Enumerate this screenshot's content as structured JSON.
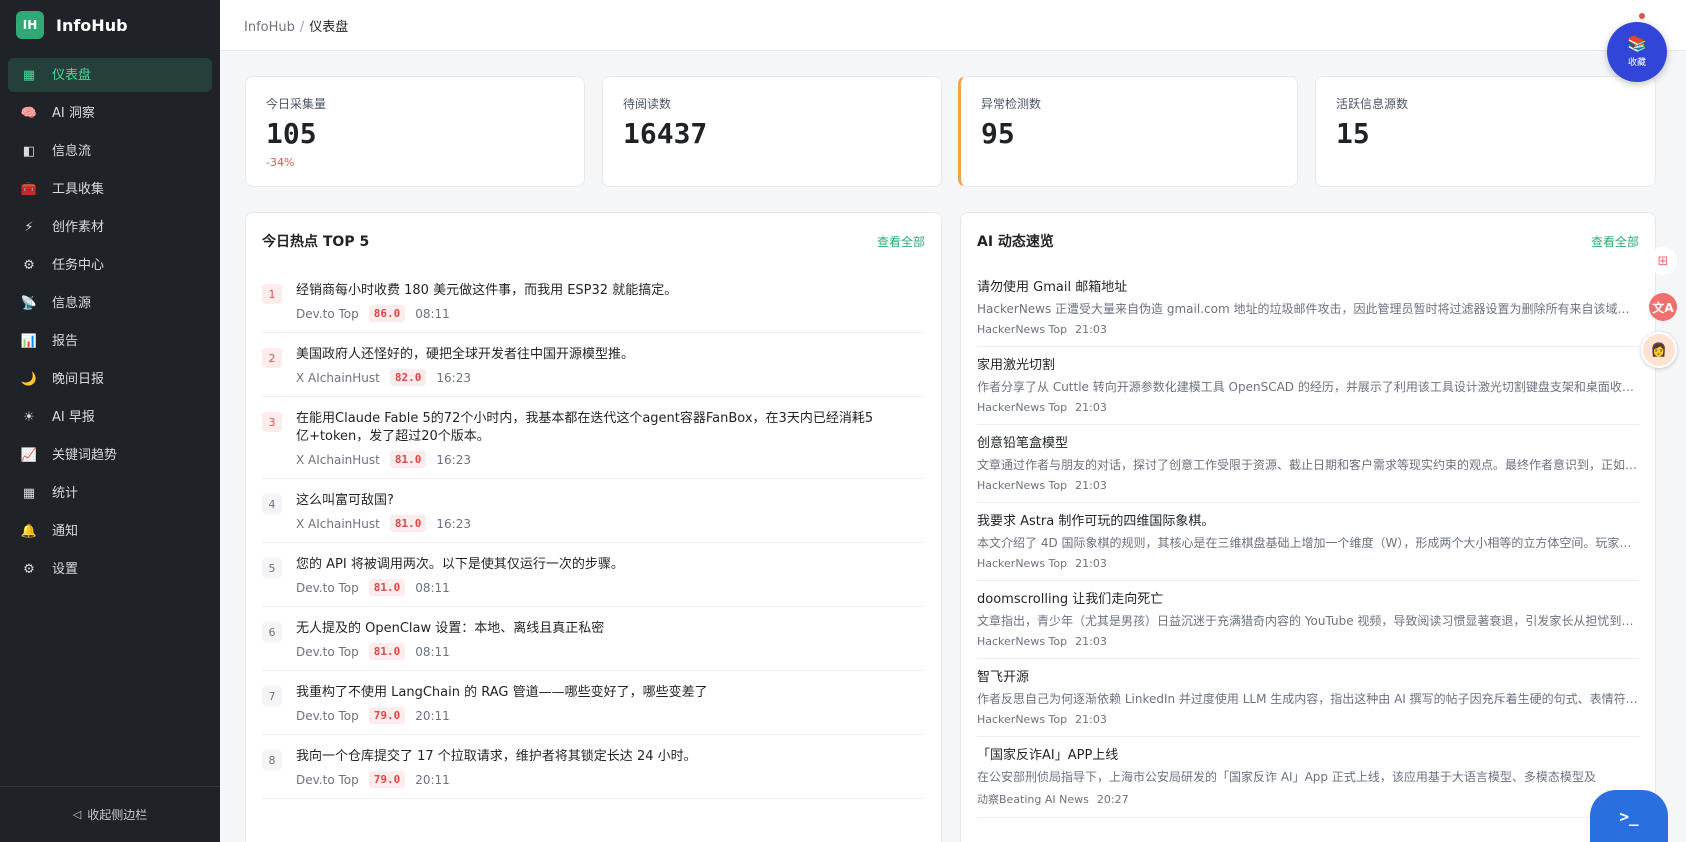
{
  "brand": {
    "logo": "IH",
    "name": "InfoHub"
  },
  "nav": [
    {
      "icon": "▦",
      "label": "仪表盘",
      "active": true
    },
    {
      "icon": "🧠",
      "label": "AI 洞察"
    },
    {
      "icon": "◧",
      "label": "信息流"
    },
    {
      "icon": "🧰",
      "label": "工具收集"
    },
    {
      "icon": "⚡",
      "label": "创作素材"
    },
    {
      "icon": "⚙",
      "label": "任务中心"
    },
    {
      "icon": "📡",
      "label": "信息源"
    },
    {
      "icon": "📊",
      "label": "报告"
    },
    {
      "icon": "🌙",
      "label": "晚间日报"
    },
    {
      "icon": "☀",
      "label": "AI 早报"
    },
    {
      "icon": "📈",
      "label": "关键词趋势"
    },
    {
      "icon": "▦",
      "label": "统计"
    },
    {
      "icon": "🔔",
      "label": "通知"
    },
    {
      "icon": "⚙",
      "label": "设置"
    }
  ],
  "collapse": {
    "icon": "◁",
    "label": "收起侧边栏"
  },
  "breadcrumb": {
    "root": "InfoHub",
    "sep": "/",
    "current": "仪表盘"
  },
  "stats": [
    {
      "label": "今日采集量",
      "value": "105",
      "delta": "-34%"
    },
    {
      "label": "待阅读数",
      "value": "16437"
    },
    {
      "label": "异常检测数",
      "value": "95"
    },
    {
      "label": "活跃信息源数",
      "value": "15"
    }
  ],
  "hot": {
    "title": "今日热点 TOP 5",
    "link": "查看全部",
    "items": [
      {
        "rank": "1",
        "title": "经销商每小时收费 180 美元做这件事，而我用 ESP32 就能搞定。",
        "source": "Dev.to Top",
        "score": "86.0",
        "time": "08:11"
      },
      {
        "rank": "2",
        "title": "美国政府人还怪好的，硬把全球开发者往中国开源模型推。",
        "source": "X AIchainHust",
        "score": "82.0",
        "time": "16:23"
      },
      {
        "rank": "3",
        "title": "在能用Claude Fable 5的72个小时内，我基本都在迭代这个agent容器FanBox，在3天内已经消耗5亿+token，发了超过20个版本。",
        "source": "X AIchainHust",
        "score": "81.0",
        "time": "16:23"
      },
      {
        "rank": "4",
        "title": "这么叫富可敌国?",
        "source": "X AIchainHust",
        "score": "81.0",
        "time": "16:23"
      },
      {
        "rank": "5",
        "title": "您的 API 将被调用两次。以下是使其仅运行一次的步骤。",
        "source": "Dev.to Top",
        "score": "81.0",
        "time": "08:11"
      },
      {
        "rank": "6",
        "title": "无人提及的 OpenClaw 设置：本地、离线且真正私密",
        "source": "Dev.to Top",
        "score": "81.0",
        "time": "08:11"
      },
      {
        "rank": "7",
        "title": "我重构了不使用 LangChain 的 RAG 管道——哪些变好了，哪些变差了",
        "source": "Dev.to Top",
        "score": "79.0",
        "time": "20:11"
      },
      {
        "rank": "8",
        "title": "我向一个仓库提交了 17 个拉取请求，维护者将其锁定长达 24 小时。",
        "source": "Dev.to Top",
        "score": "79.0",
        "time": "20:11"
      }
    ]
  },
  "ai": {
    "title": "AI 动态速览",
    "link": "查看全部",
    "items": [
      {
        "title": "请勿使用 Gmail 邮箱地址",
        "desc": "HackerNews 正遭受大量来自伪造 gmail.com 地址的垃圾邮件攻击，因此管理员暂时将过滤器设置为删除所有来自该域名的邮件。",
        "source": "HackerNews Top",
        "time": "21:03"
      },
      {
        "title": "家用激光切割",
        "desc": "作者分享了从 Cuttle 转向开源参数化建模工具 OpenSCAD 的经历，并展示了利用该工具设计激光切割键盘支架和桌面收纳盒的过程。",
        "source": "HackerNews Top",
        "time": "21:03"
      },
      {
        "title": "创意铅笔盒模型",
        "desc": "文章通过作者与朋友的对话，探讨了创意工作受限于资源、截止日期和客户需求等现实约束的观点。最终作者意识到，正如铅笔盒的比喻。",
        "source": "HackerNews Top",
        "time": "21:03"
      },
      {
        "title": "我要求 Astra 制作可玩的四维国际象棋。",
        "desc": "本文介绍了 4D 国际象棋的规则，其核心是在三维棋盘基础上增加一个维度（W），形成两个大小相等的立方体空间。玩家可以在其中移动。",
        "source": "HackerNews Top",
        "time": "21:03"
      },
      {
        "title": "doomscrolling 让我们走向死亡",
        "desc": "文章指出，青少年（尤其是男孩）日益沉迷于充满猎奇内容的 YouTube 视频，导致阅读习惯显著衰退，引发家长从担忧到无奈的情绪。",
        "source": "HackerNews Top",
        "time": "21:03"
      },
      {
        "title": "智飞开源",
        "desc": "作者反思自己为何逐渐依赖 LinkedIn 并过度使用 LLM 生成内容，指出这种由 AI 撰写的帖子因充斥着生硬的句式、表情符号而令人厌倦。",
        "source": "HackerNews Top",
        "time": "21:03"
      },
      {
        "title": "「国家反诈AI」APP上线",
        "desc": "在公安部刑侦局指导下，上海市公安局研发的「国家反诈 AI」App 正式上线，该应用基于大语言模型、多模态模型及",
        "source": "动察Beating AI News",
        "time": "20:27"
      }
    ]
  },
  "widgets": {
    "fav_icon": "📚",
    "fav_label": "收藏",
    "grid_icon": "⊞",
    "translate_icon": "文A",
    "avatar_icon": "👩",
    "terminal_icon": ">_"
  },
  "colors": {
    "accent": "#2faa75",
    "sidebar_bg": "#1f2328",
    "warn": "#f0a347",
    "score_red": "#d94848"
  }
}
